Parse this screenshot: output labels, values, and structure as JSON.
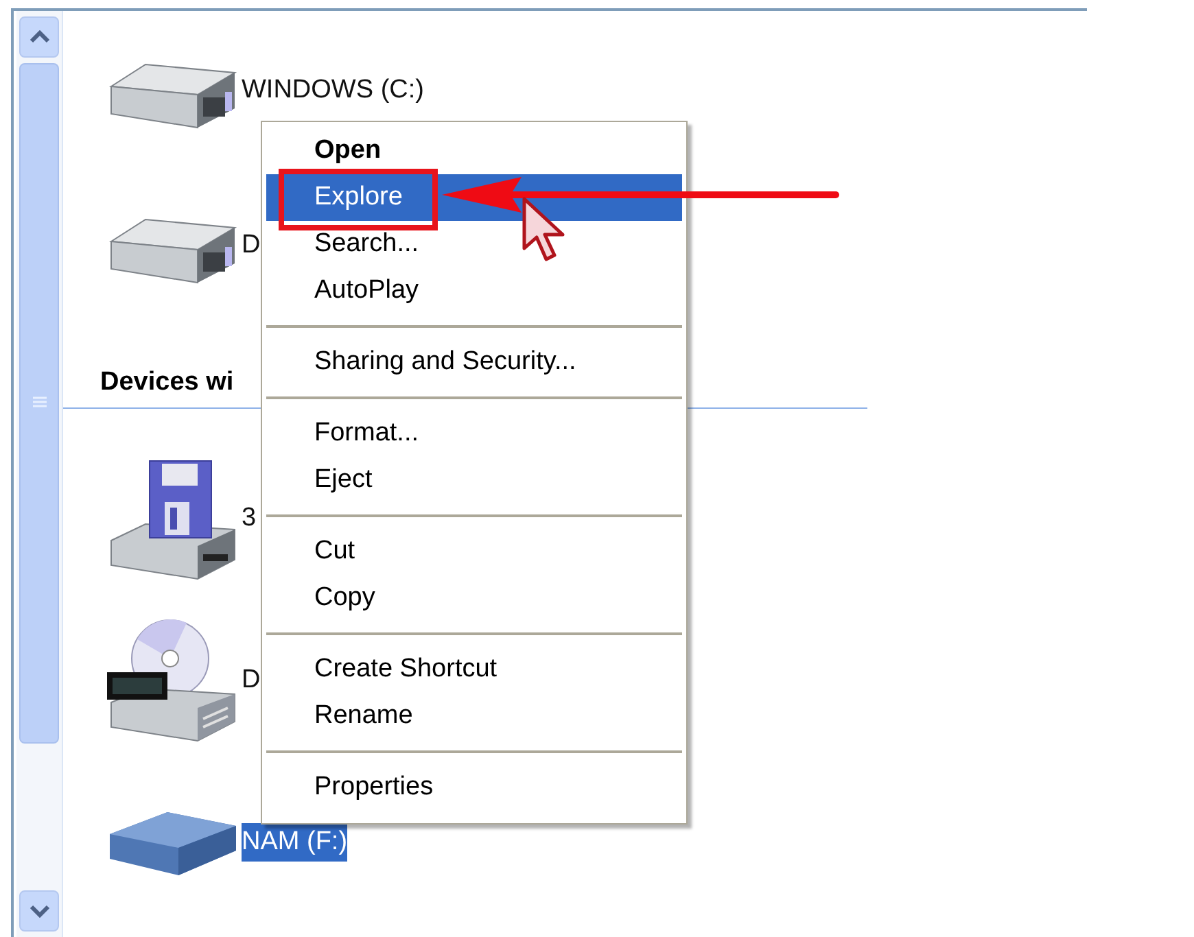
{
  "drives": [
    {
      "label": "WINDOWS (C:)",
      "kind": "hdd",
      "selected": false
    },
    {
      "label": "D",
      "kind": "hdd",
      "selected": false
    }
  ],
  "section": {
    "title": "Devices wi"
  },
  "devices": [
    {
      "label": "3",
      "kind": "floppy",
      "selected": false
    },
    {
      "label": "D",
      "kind": "dvd",
      "selected": false
    },
    {
      "label": "NAM (F:)",
      "kind": "removable",
      "selected": true
    }
  ],
  "context_menu": {
    "groups": [
      [
        {
          "label": "Open",
          "default": true,
          "selected": false
        },
        {
          "label": "Explore",
          "default": false,
          "selected": true
        },
        {
          "label": "Search...",
          "default": false,
          "selected": false
        },
        {
          "label": "AutoPlay",
          "default": false,
          "selected": false
        }
      ],
      [
        {
          "label": "Sharing and Security...",
          "default": false,
          "selected": false
        }
      ],
      [
        {
          "label": "Format...",
          "default": false,
          "selected": false
        },
        {
          "label": "Eject",
          "default": false,
          "selected": false
        }
      ],
      [
        {
          "label": "Cut",
          "default": false,
          "selected": false
        },
        {
          "label": "Copy",
          "default": false,
          "selected": false
        }
      ],
      [
        {
          "label": "Create Shortcut",
          "default": false,
          "selected": false
        },
        {
          "label": "Rename",
          "default": false,
          "selected": false
        }
      ],
      [
        {
          "label": "Properties",
          "default": false,
          "selected": false
        }
      ]
    ]
  }
}
